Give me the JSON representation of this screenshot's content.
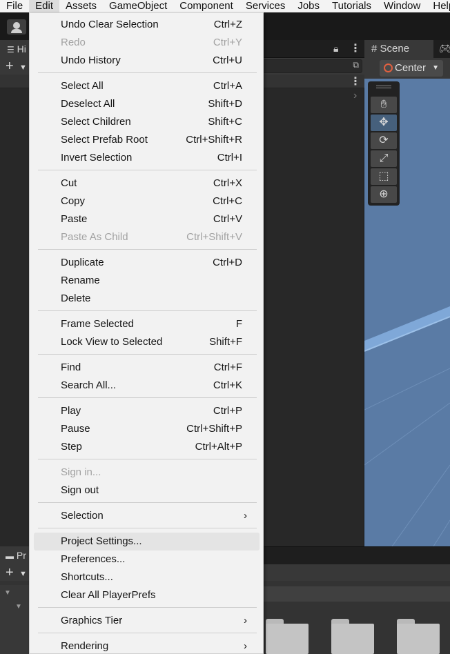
{
  "menubar": [
    "File",
    "Edit",
    "Assets",
    "GameObject",
    "Component",
    "Services",
    "Jobs",
    "Tutorials",
    "Window",
    "Help"
  ],
  "hierarchy_tab": "Hi",
  "scene_tab": "Scene",
  "pivot_button": "Center",
  "project_tab": "Pr",
  "menu": {
    "items": [
      {
        "label": "Undo Clear Selection",
        "shortcut": "Ctrl+Z"
      },
      {
        "label": "Redo",
        "shortcut": "Ctrl+Y",
        "disabled": true
      },
      {
        "label": "Undo History",
        "shortcut": "Ctrl+U"
      },
      {
        "label": "Select All",
        "shortcut": "Ctrl+A"
      },
      {
        "label": "Deselect All",
        "shortcut": "Shift+D"
      },
      {
        "label": "Select Children",
        "shortcut": "Shift+C"
      },
      {
        "label": "Select Prefab Root",
        "shortcut": "Ctrl+Shift+R"
      },
      {
        "label": "Invert Selection",
        "shortcut": "Ctrl+I"
      },
      {
        "label": "Cut",
        "shortcut": "Ctrl+X"
      },
      {
        "label": "Copy",
        "shortcut": "Ctrl+C"
      },
      {
        "label": "Paste",
        "shortcut": "Ctrl+V"
      },
      {
        "label": "Paste As Child",
        "shortcut": "Ctrl+Shift+V",
        "disabled": true
      },
      {
        "label": "Duplicate",
        "shortcut": "Ctrl+D"
      },
      {
        "label": "Rename",
        "shortcut": ""
      },
      {
        "label": "Delete",
        "shortcut": ""
      },
      {
        "label": "Frame Selected",
        "shortcut": "F"
      },
      {
        "label": "Lock View to Selected",
        "shortcut": "Shift+F"
      },
      {
        "label": "Find",
        "shortcut": "Ctrl+F"
      },
      {
        "label": "Search All...",
        "shortcut": "Ctrl+K"
      },
      {
        "label": "Play",
        "shortcut": "Ctrl+P"
      },
      {
        "label": "Pause",
        "shortcut": "Ctrl+Shift+P"
      },
      {
        "label": "Step",
        "shortcut": "Ctrl+Alt+P"
      },
      {
        "label": "Sign in...",
        "shortcut": "",
        "disabled": true
      },
      {
        "label": "Sign out",
        "shortcut": ""
      },
      {
        "label": "Selection",
        "shortcut": "",
        "submenu": true
      },
      {
        "label": "Project Settings...",
        "shortcut": "",
        "hover": true
      },
      {
        "label": "Preferences...",
        "shortcut": ""
      },
      {
        "label": "Shortcuts...",
        "shortcut": ""
      },
      {
        "label": "Clear All PlayerPrefs",
        "shortcut": ""
      },
      {
        "label": "Graphics Tier",
        "shortcut": "",
        "submenu": true
      },
      {
        "label": "Rendering",
        "shortcut": "",
        "submenu": true
      }
    ]
  },
  "colors": {
    "menu_bg": "#f2f2f2",
    "editor_dark": "#282828",
    "scene_blue": "#5a7ba5",
    "disabled_text": "#a2a2a2"
  }
}
